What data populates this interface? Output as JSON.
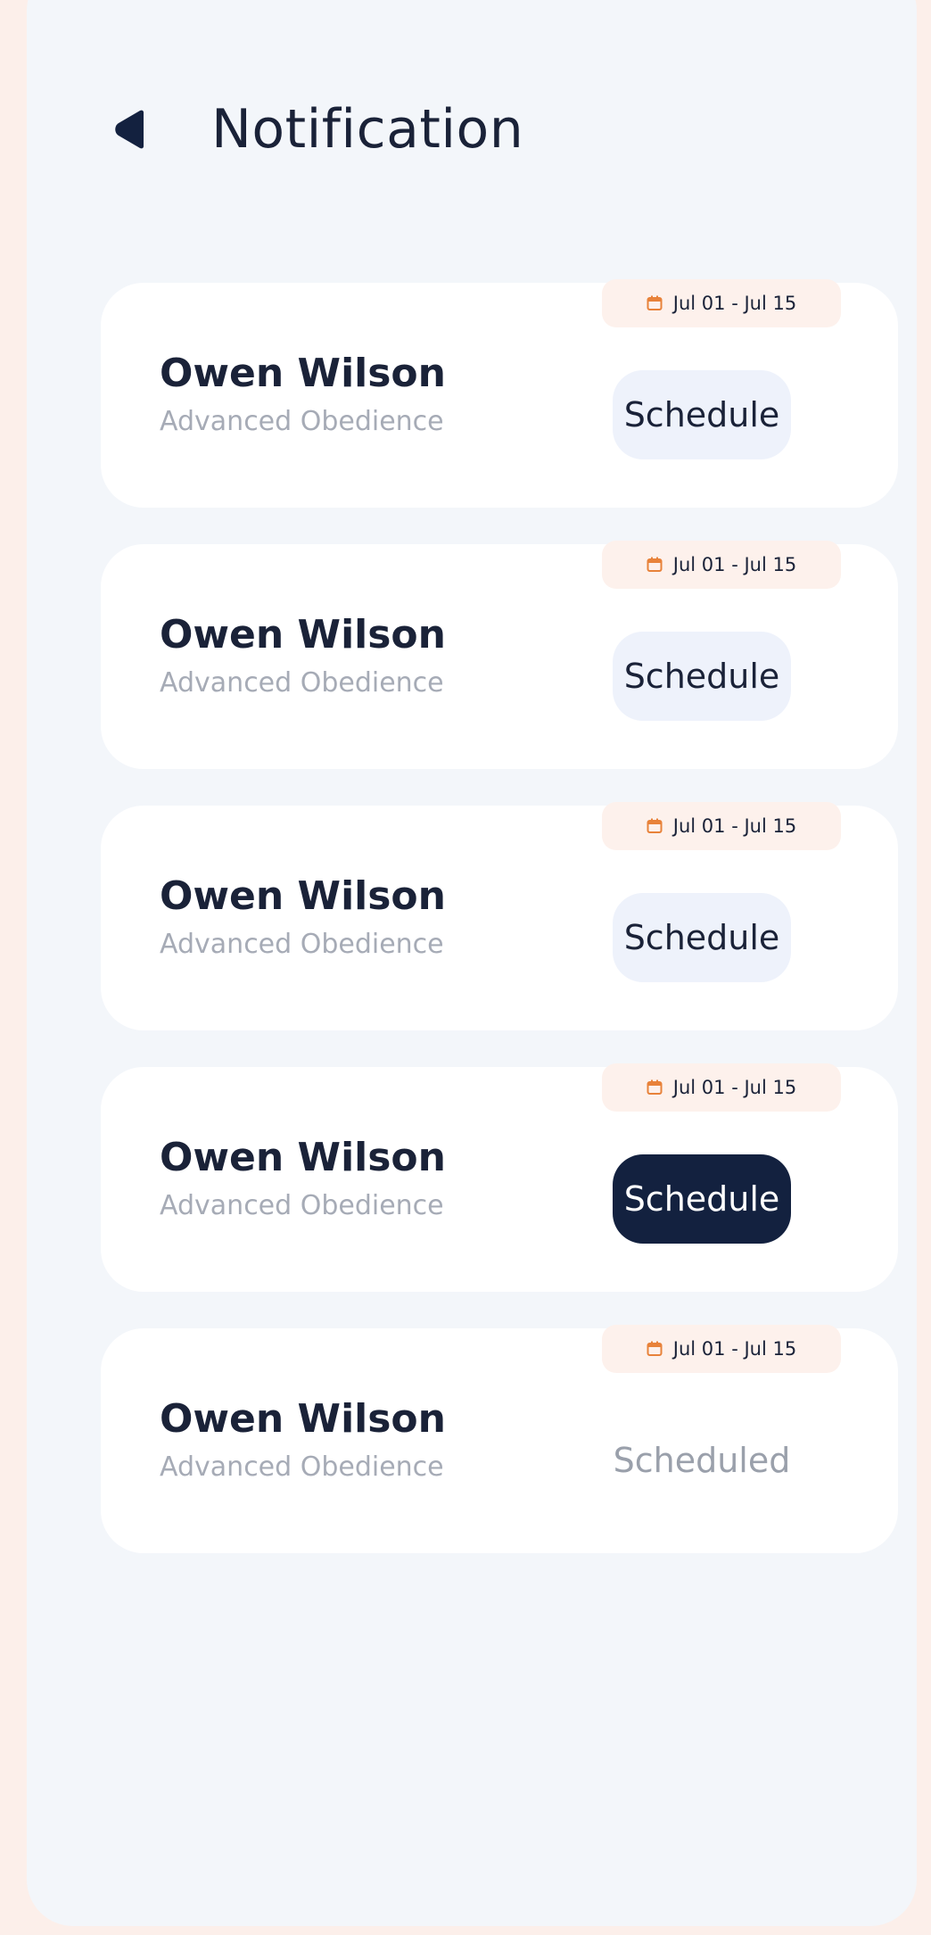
{
  "header": {
    "title": "Notification"
  },
  "notifications": [
    {
      "date": "Jul 01 - Jul 15",
      "name": "Owen Wilson",
      "course": "Advanced Obedience",
      "action": "Schedule",
      "style": "light"
    },
    {
      "date": "Jul 01 - Jul 15",
      "name": "Owen Wilson",
      "course": "Advanced Obedience",
      "action": "Schedule",
      "style": "light"
    },
    {
      "date": "Jul 01 - Jul 15",
      "name": "Owen Wilson",
      "course": "Advanced Obedience",
      "action": "Schedule",
      "style": "light"
    },
    {
      "date": "Jul 01 - Jul 15",
      "name": "Owen Wilson",
      "course": "Advanced Obedience",
      "action": "Schedule",
      "style": "dark"
    },
    {
      "date": "Jul 01 - Jul 15",
      "name": "Owen Wilson",
      "course": "Advanced Obedience",
      "action": "Scheduled",
      "style": "done"
    }
  ],
  "colors": {
    "navy": "#13213f",
    "accent": "#e8823a",
    "badge_bg": "#fdf1ec",
    "button_light_bg": "#eef2fb",
    "muted_text": "#a6abb6"
  },
  "icons": {
    "back": "back-arrow-icon",
    "date": "calendar-icon"
  }
}
